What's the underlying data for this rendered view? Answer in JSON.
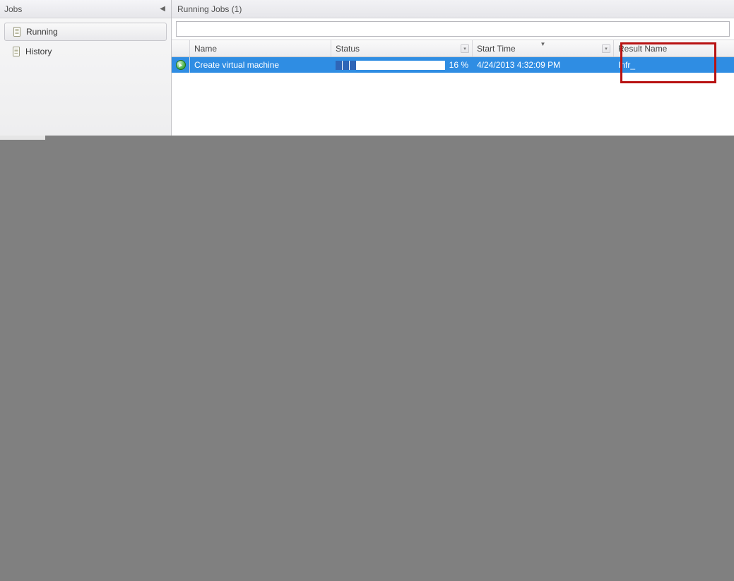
{
  "sidebar": {
    "title": "Jobs",
    "items": [
      {
        "label": "Running",
        "active": true
      },
      {
        "label": "History",
        "active": false
      }
    ]
  },
  "main": {
    "title": "Running Jobs (1)"
  },
  "search": {
    "value": "",
    "placeholder": ""
  },
  "columns": {
    "name": "Name",
    "status": "Status",
    "start_time": "Start Time",
    "result_name": "Result Name"
  },
  "jobs": [
    {
      "name": "Create virtual machine",
      "progress_pct": 16,
      "progress_text": "16 %",
      "start_time": "4/24/2013 4:32:09 PM",
      "result_name": "Infr_"
    }
  ]
}
